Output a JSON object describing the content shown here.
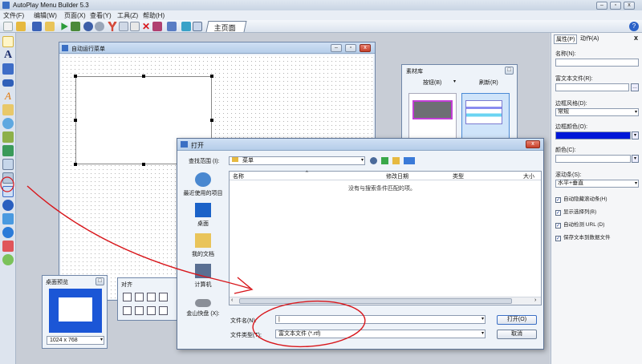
{
  "app": {
    "title": "AutoPlay Menu Builder 5.3"
  },
  "menu": [
    "文件(F)",
    "编辑(W)",
    "页面(X)",
    "查看(Y)",
    "工具(Z)",
    "帮助(H)"
  ],
  "toolbar": {
    "tab_label": "主页面"
  },
  "menu_window": {
    "title": "自动运行菜单"
  },
  "library": {
    "title": "素材库",
    "dropdown": "按钮(B)",
    "refresh": "刷新(R)"
  },
  "preview": {
    "title": "桌面预览",
    "resolution": "1024 x 768"
  },
  "align": {
    "title": "对齐"
  },
  "panel": {
    "tabs": [
      "属性(P)",
      "动作(A)"
    ],
    "close": "x",
    "name_label": "名称(N):",
    "rtf_label": "富文本文件(R):",
    "border_style_label": "边框风格(D):",
    "border_style_value": "常规",
    "border_color_label": "边框颜色(O):",
    "border_color": "#0018d8",
    "color_label": "颜色(C):",
    "scrollbar_label": "滚动条(S):",
    "scrollbar_value": "水平+垂直",
    "checkboxes": [
      "自动隐藏滚动条(H)",
      "显示选择列(B)",
      "自动检测 URL (D)",
      "保存文本到数据文件"
    ]
  },
  "dialog": {
    "title": "打开",
    "look_in_label": "查找范围 (I):",
    "look_in_value": "菜单",
    "places": [
      "最近使用的项目",
      "桌面",
      "我的文档",
      "计算机",
      "金山快盘 (X):"
    ],
    "columns": [
      "名称",
      "修改日期",
      "类型",
      "大小"
    ],
    "empty_message": "没有与搜索条件匹配的项。",
    "filename_label": "文件名(N):",
    "filename_value": "|",
    "filetype_label": "文件类型(T):",
    "filetype_value": "富文本文件 (*.rtf)",
    "open_button": "打开(O)",
    "cancel_button": "取消"
  },
  "colors": {
    "annotation": "#d8161b",
    "accent": "#0018d8"
  }
}
